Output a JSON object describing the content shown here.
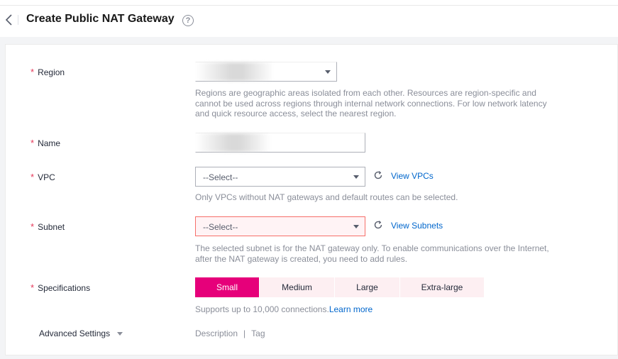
{
  "header": {
    "title": "Create Public NAT Gateway",
    "help_glyph": "?",
    "back_icon": "chevron-left-icon"
  },
  "form": {
    "region": {
      "label": "Region",
      "required_mark": "*",
      "value": "",
      "hint": "Regions are geographic areas isolated from each other. Resources are region-specific and cannot be used across regions through internal network connections. For low network latency and quick resource access, select the nearest region."
    },
    "name": {
      "label": "Name",
      "required_mark": "*",
      "value": ""
    },
    "vpc": {
      "label": "VPC",
      "required_mark": "*",
      "value": "--Select--",
      "link": "View VPCs",
      "hint": "Only VPCs without NAT gateways and default routes can be selected."
    },
    "subnet": {
      "label": "Subnet",
      "required_mark": "*",
      "value": "--Select--",
      "link": "View Subnets",
      "hint": "The selected subnet is for the NAT gateway only. To enable communications over the Internet, after the NAT gateway is created, you need to add rules."
    },
    "specifications": {
      "label": "Specifications",
      "required_mark": "*",
      "options": [
        "Small",
        "Medium",
        "Large",
        "Extra-large"
      ],
      "selected": "Small",
      "hint": "Supports up to 10,000 connections.",
      "hint_link": "Learn more"
    },
    "advanced": {
      "label": "Advanced Settings",
      "items": [
        "Description",
        "Tag"
      ],
      "separator": "|"
    }
  },
  "colors": {
    "accent": "#e6007a",
    "accent_light": "#fdeff2",
    "required": "#e5395a",
    "link": "#0066cc",
    "error_border": "#f66f6a"
  }
}
